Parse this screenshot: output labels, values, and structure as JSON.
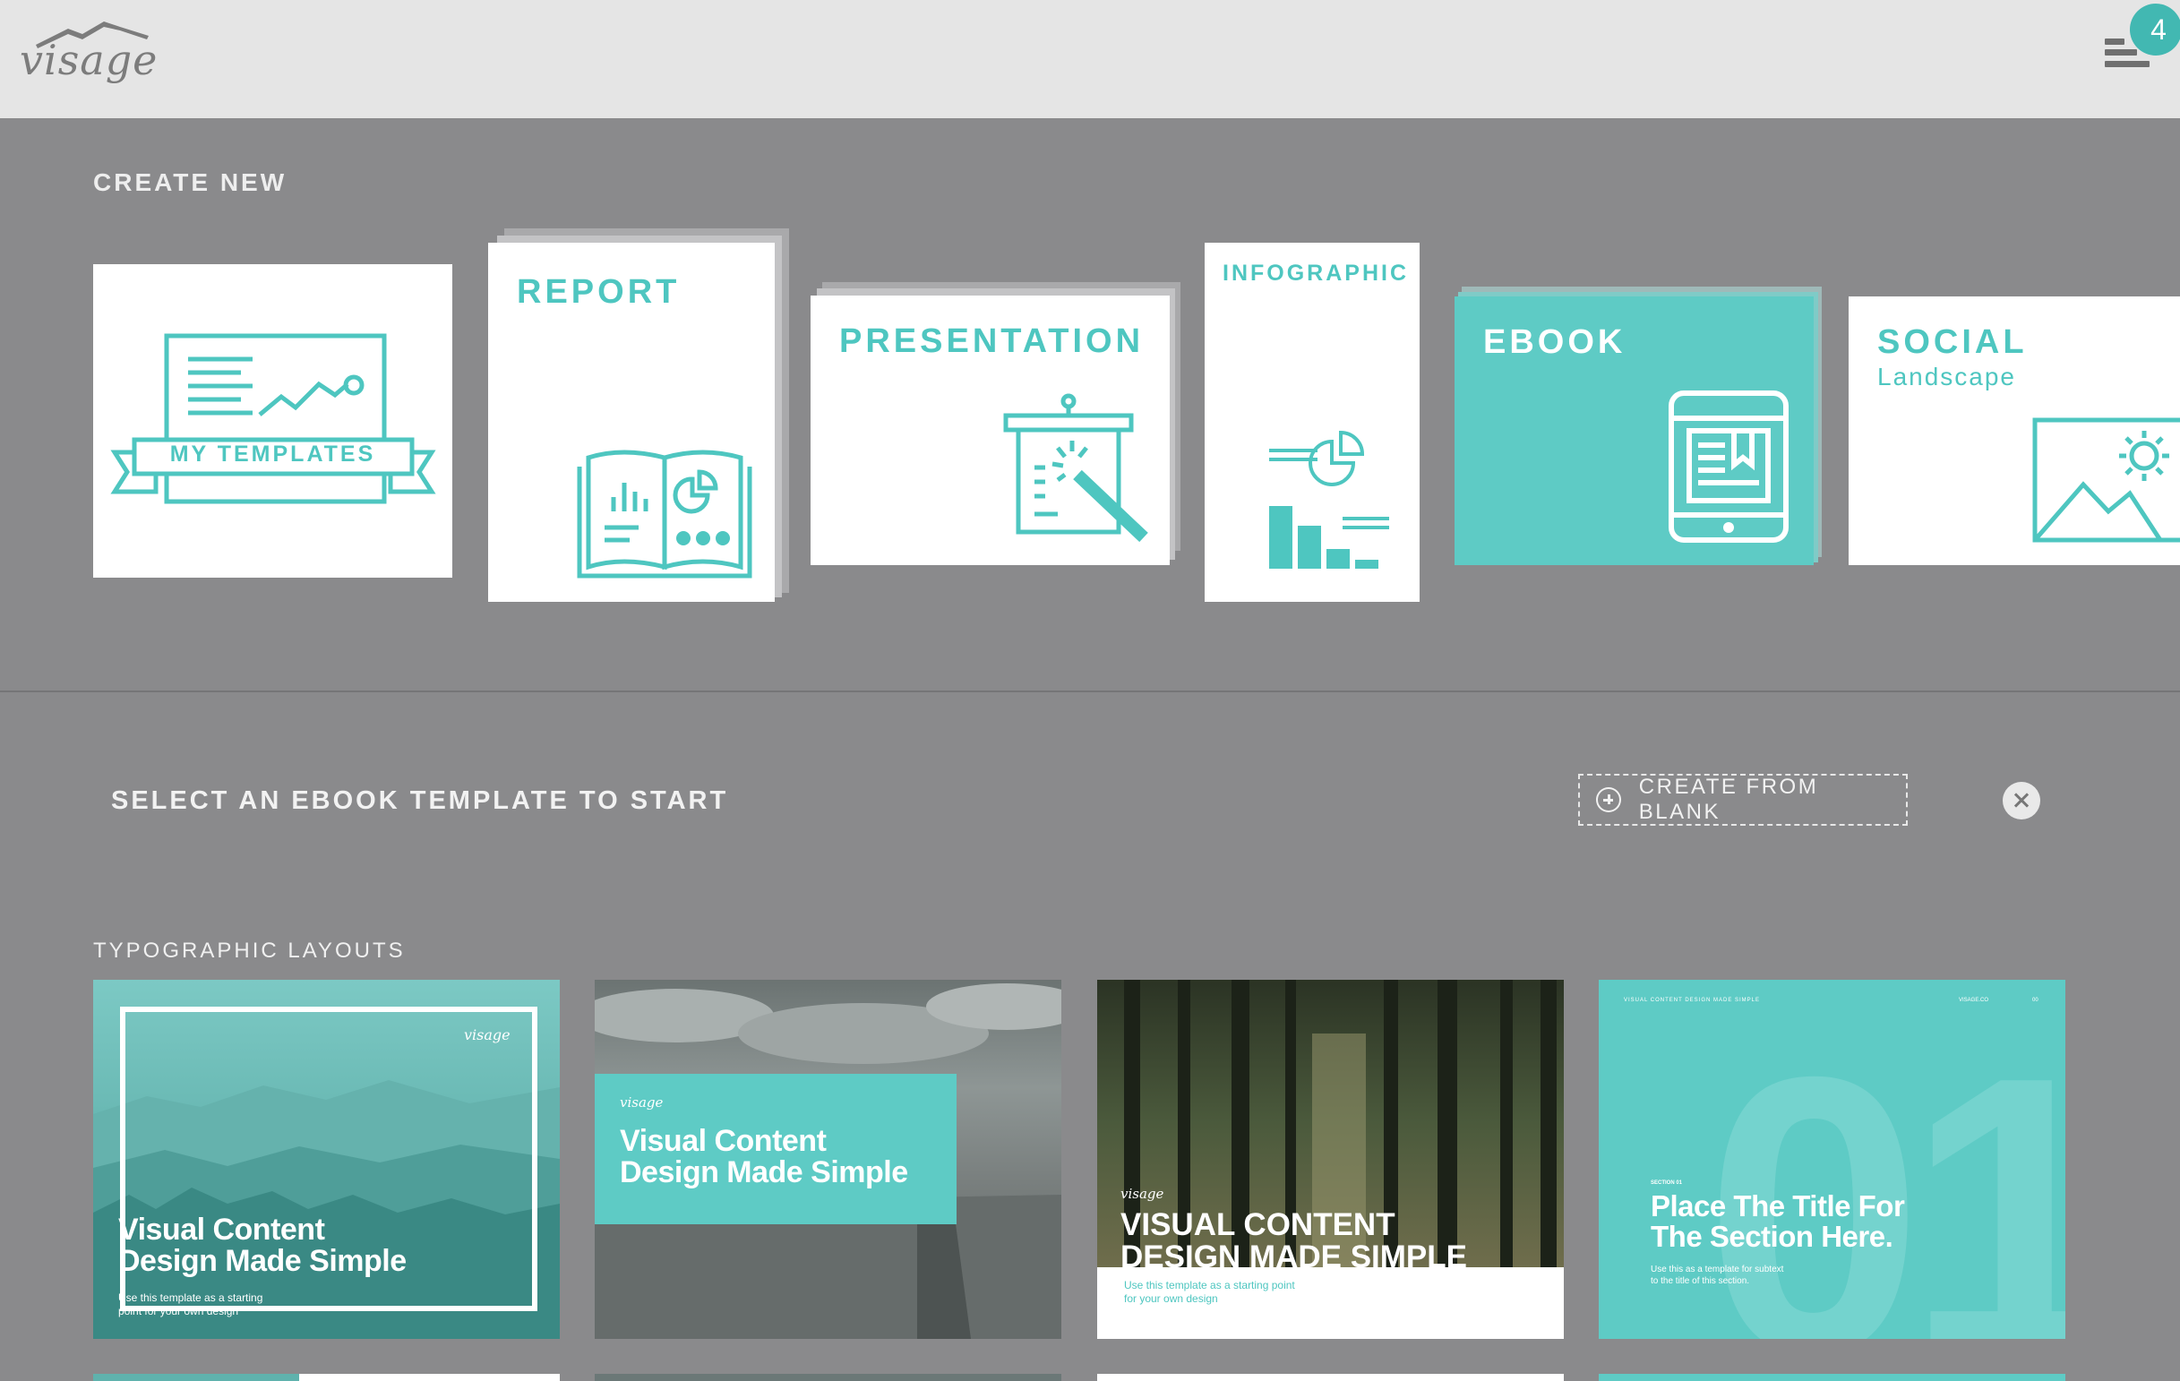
{
  "header": {
    "logo_text": "visage",
    "notification_count": "4"
  },
  "create_new": {
    "title": "CREATE NEW",
    "cards": {
      "my_templates": "MY TEMPLATES",
      "report": "REPORT",
      "presentation": "PRESENTATION",
      "infographic": "INFOGRAPHIC",
      "ebook": "EBOOK",
      "social": "SOCIAL",
      "social_sub": "Landscape"
    }
  },
  "select_section": {
    "title": "SELECT AN EBOOK TEMPLATE TO START",
    "create_from_blank": "CREATE FROM BLANK"
  },
  "typographic": {
    "title": "TYPOGRAPHIC LAYOUTS",
    "templates": [
      {
        "logo": "visage",
        "title_line1": "Visual Content",
        "title_line2": "Design Made Simple",
        "sub_line1": "Use this template as a starting",
        "sub_line2": "point for your own design"
      },
      {
        "logo": "visage",
        "title_line1": "Visual Content",
        "title_line2": "Design Made Simple"
      },
      {
        "logo": "visage",
        "title_line1": "VISUAL CONTENT",
        "title_line2": "DESIGN MADE SIMPLE",
        "sub_line1": "Use this template as a starting point",
        "sub_line2": "for your own design"
      },
      {
        "header_left": "VISUAL CONTENT DESIGN MADE SIMPLE",
        "header_mid": "VISAGE.CO",
        "header_right": "00",
        "big_number": "01",
        "section_label": "SECTION 01",
        "title_line1": "Place The Title For",
        "title_line2": "The Section Here.",
        "sub_line1": "Use this as a template for subtext",
        "sub_line2": "to the title of this section."
      }
    ]
  },
  "colors": {
    "accent": "#4ec6c0",
    "header_bg": "#e5e5e5",
    "page_bg": "#8a8a8c",
    "badge": "#42b8b2"
  }
}
